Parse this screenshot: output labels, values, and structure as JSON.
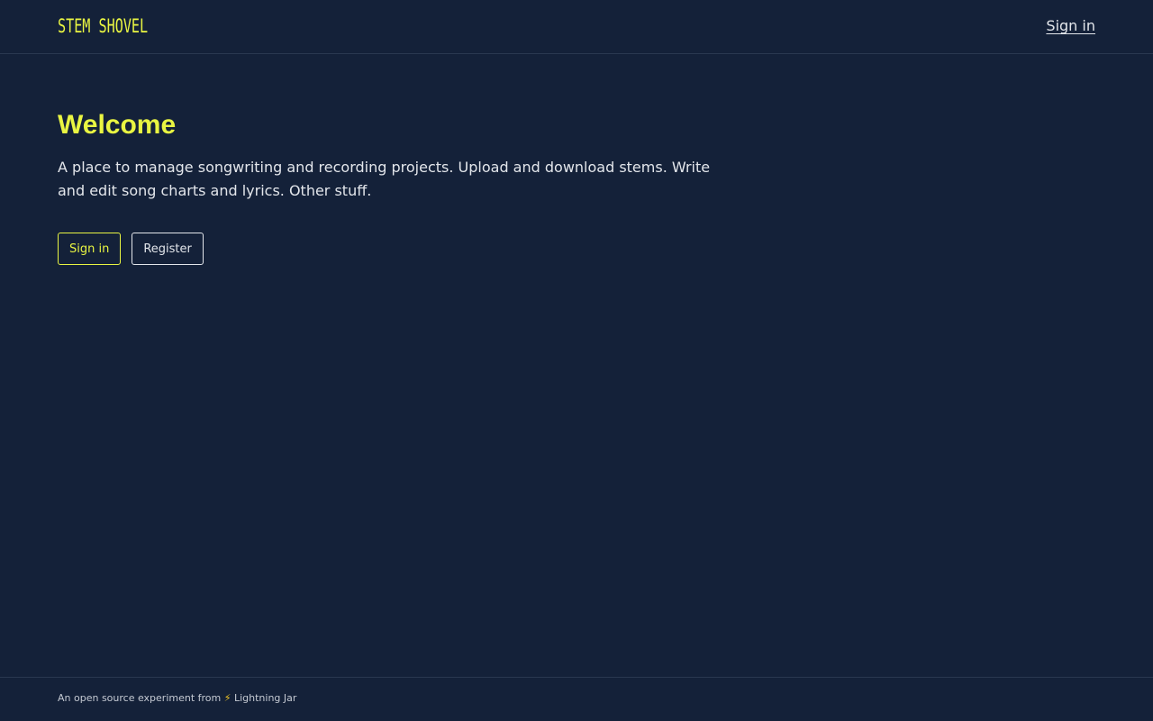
{
  "header": {
    "logo_text": "STEM SHOVEL",
    "sign_in_link": "Sign in"
  },
  "main": {
    "title": "Welcome",
    "description": "A place to manage songwriting and recording projects. Upload and download stems. Write and edit song charts and lyrics. Other stuff.",
    "sign_in_button": "Sign in",
    "register_button": "Register"
  },
  "footer": {
    "text": "An open source experiment from",
    "bolt_icon": "⚡",
    "link_text": "Lightning Jar"
  },
  "colors": {
    "background": "#142139",
    "accent": "#e9f542",
    "text": "#e3e6eb"
  }
}
